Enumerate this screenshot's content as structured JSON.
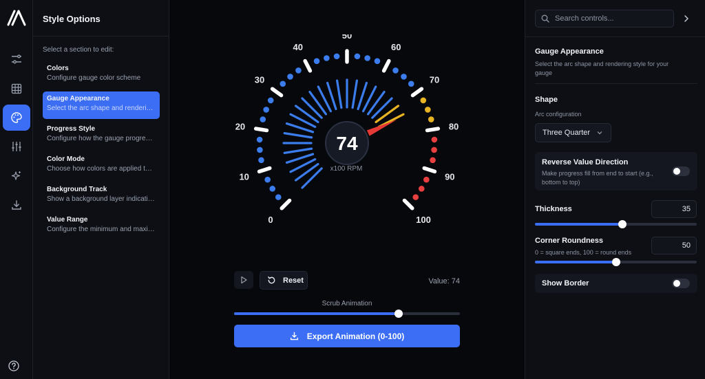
{
  "colors": {
    "accent": "#3b6ef5",
    "gauge_blue": "#3b7ded",
    "gauge_yellow": "#e8b423",
    "gauge_red": "#e84040",
    "needle": "#e53935",
    "tick_white": "#ffffff"
  },
  "rail": {
    "icons": [
      "logo-icon",
      "sliders-icon",
      "grid-icon",
      "palette-icon",
      "equalizer-icon",
      "sparkles-icon",
      "download-icon"
    ],
    "active": "palette-icon",
    "help_icon": "help-icon"
  },
  "sections_panel": {
    "title": "Style Options",
    "hint": "Select a section to edit:",
    "items": [
      {
        "title": "Colors",
        "desc": "Configure gauge color scheme"
      },
      {
        "title": "Gauge Appearance",
        "desc": "Select the arc shape and rendering style for your gauge"
      },
      {
        "title": "Progress Style",
        "desc": "Configure how the gauge progress is drawn"
      },
      {
        "title": "Color Mode",
        "desc": "Choose how colors are applied to the gauge"
      },
      {
        "title": "Background Track",
        "desc": "Show a background layer indicating the full range"
      },
      {
        "title": "Value Range",
        "desc": "Configure the minimum and maximum values"
      }
    ],
    "active_index": 1
  },
  "gauge": {
    "value": 74,
    "display_value": "74",
    "unit": "x100 RPM",
    "min": 0,
    "max": 100,
    "labels": [
      "0",
      "10",
      "20",
      "30",
      "40",
      "50",
      "60",
      "70",
      "80",
      "90",
      "100"
    ],
    "warning_from": 70,
    "danger_from": 80
  },
  "controls": {
    "reset_label": "Reset",
    "value_text": "Value: 74",
    "scrub_label": "Scrub Animation",
    "scrub_fraction": 0.73,
    "export_label": "Export Animation (0-100)"
  },
  "settings": {
    "search_placeholder": "Search controls...",
    "section_title": "Gauge Appearance",
    "section_desc": "Select the arc shape and rendering style for your gauge",
    "shape_title": "Shape",
    "shape_sub": "Arc configuration",
    "shape_value": "Three Quarter",
    "reverse_title": "Reverse Value Direction",
    "reverse_desc": "Make progress fill from end to start (e.g., bottom to top)",
    "reverse_on": false,
    "thickness_label": "Thickness",
    "thickness_value": "35",
    "thickness_fraction": 0.54,
    "roundness_label": "Corner Roundness",
    "roundness_desc": "0 = square ends, 100 = round ends",
    "roundness_value": "50",
    "roundness_fraction": 0.5,
    "border_label": "Show Border",
    "border_on": false
  }
}
